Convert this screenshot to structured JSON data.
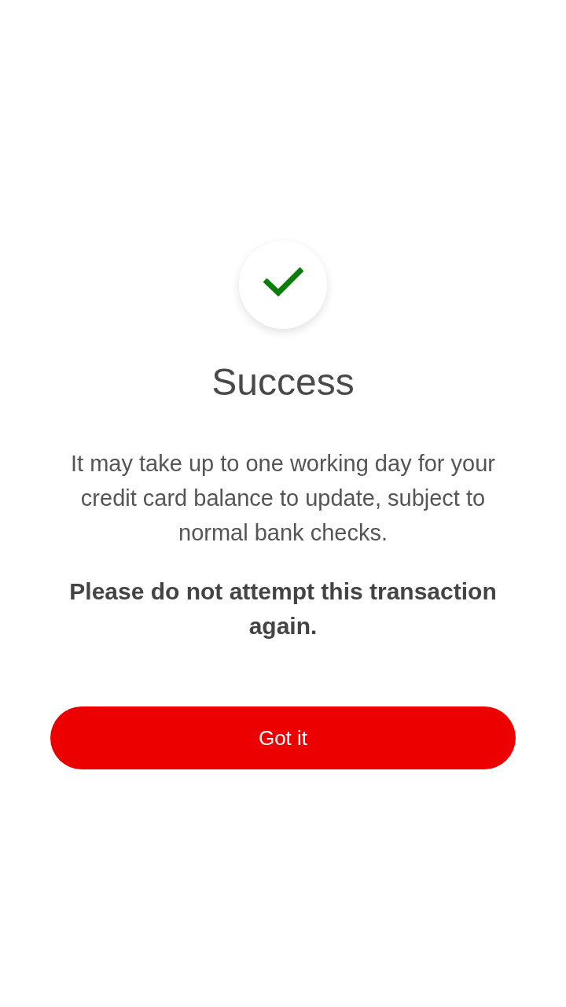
{
  "status": {
    "kind": "success"
  },
  "title": "Success",
  "message": "It may take up to one working day for your credit card balance to update, subject to normal bank checks.",
  "warning": "Please do not attempt this transaction again.",
  "button": {
    "label": "Got it"
  }
}
